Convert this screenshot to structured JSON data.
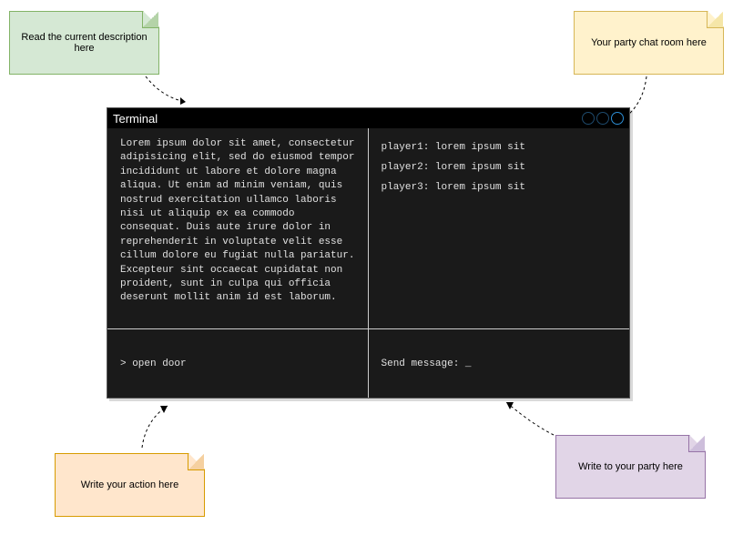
{
  "notes": {
    "description": "Read the current description here",
    "chatroom": "Your party chat room here",
    "action": "Write your action here",
    "send": "Write to your party here"
  },
  "terminal": {
    "title": "Terminal",
    "description": "Lorem ipsum dolor sit amet, consectetur adipisicing elit, sed do eiusmod tempor incididunt ut labore et dolore magna aliqua. Ut enim ad minim veniam, quis nostrud exercitation ullamco laboris nisi ut aliquip ex ea commodo consequat. Duis aute irure dolor in reprehenderit in voluptate velit esse cillum dolore eu fugiat nulla pariatur. Excepteur sint occaecat cupidatat non proident, sunt in culpa qui officia deserunt mollit anim id est laborum.",
    "chat": [
      {
        "name": "player1",
        "msg": "lorem ipsum sit"
      },
      {
        "name": "player2",
        "msg": "lorem ipsum sit"
      },
      {
        "name": "player3",
        "msg": "lorem ipsum sit"
      }
    ],
    "command_prompt": "> open door",
    "send_prompt": "Send message: _"
  }
}
